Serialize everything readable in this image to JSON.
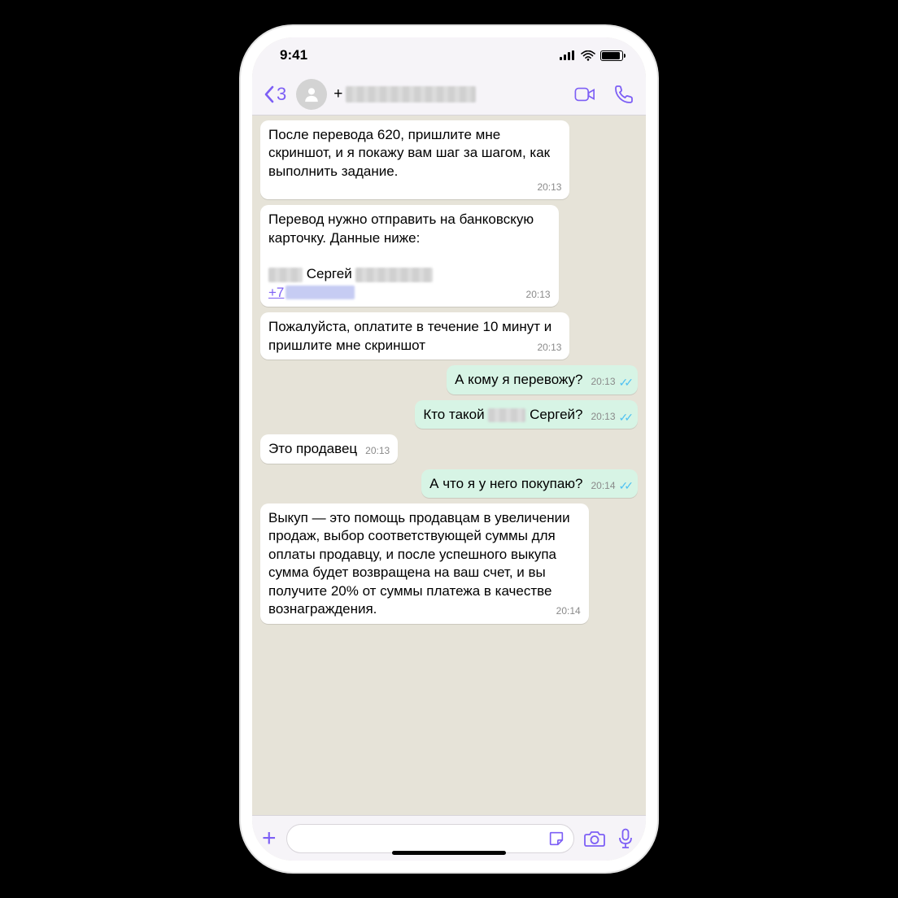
{
  "status": {
    "time": "9:41"
  },
  "header": {
    "back_count": "3",
    "phone_prefix": "+"
  },
  "messages": {
    "m1": {
      "text": "После перевода 620, пришлите мне скриншот, и я покажу вам шаг за шагом, как выполнить задание.",
      "time": "20:13"
    },
    "m2": {
      "text_a": "Перевод нужно отправить на банковскую карточку. Данные ниже:",
      "name_mid": " Сергей ",
      "phone_prefix": "+7",
      "time": "20:13"
    },
    "m3": {
      "text": "Пожалуйста, оплатите в течение 10 минут и пришлите мне скриншот",
      "time": "20:13"
    },
    "m4": {
      "text": "А кому я перевожу?",
      "time": "20:13"
    },
    "m5": {
      "text_a": "Кто такой ",
      "text_b": " Сергей?",
      "time": "20:13"
    },
    "m6": {
      "text": "Это продавец",
      "time": "20:13"
    },
    "m7": {
      "text": "А что я у него покупаю?",
      "time": "20:14"
    },
    "m8": {
      "text": "Выкуп — это помощь продавцам в увеличении продаж, выбор соответствующей суммы для оплаты продавцу, и после успешного выкупа сумма будет возвращена на ваш счет, и вы получите 20% от суммы платежа в качестве вознаграждения.",
      "time": "20:14"
    }
  }
}
